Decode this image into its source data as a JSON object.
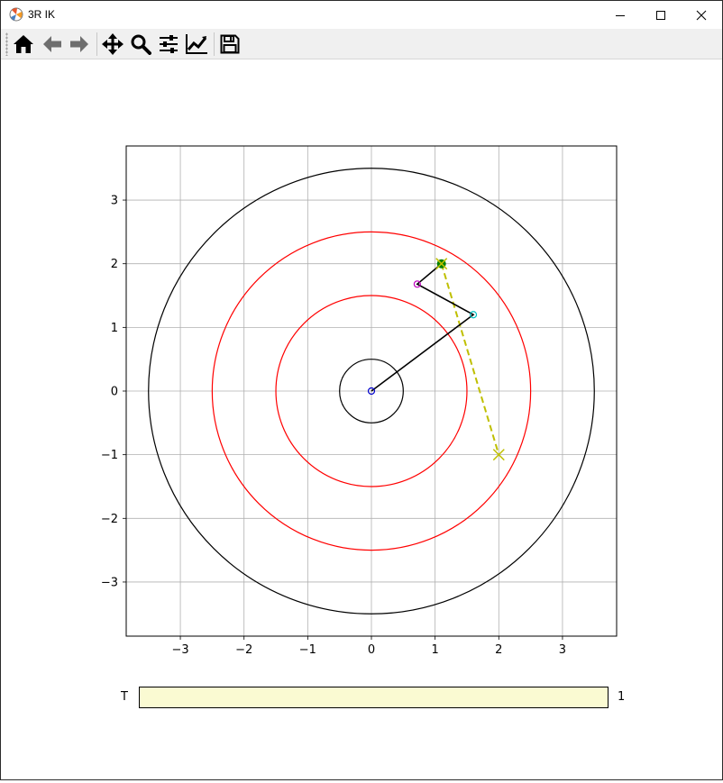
{
  "window": {
    "title": "3R IK"
  },
  "toolbar": {
    "buttons": [
      {
        "name": "home-button",
        "icon": "home-icon"
      },
      {
        "name": "back-button",
        "icon": "arrow-left-icon"
      },
      {
        "name": "forward-button",
        "icon": "arrow-right-icon"
      },
      {
        "name": "pan-button",
        "icon": "move-icon"
      },
      {
        "name": "zoom-button",
        "icon": "magnifier-icon"
      },
      {
        "name": "configure-subplots-button",
        "icon": "sliders-icon"
      },
      {
        "name": "edit-axis-button",
        "icon": "line-chart-icon"
      },
      {
        "name": "save-button",
        "icon": "floppy-disk-icon"
      }
    ]
  },
  "slider": {
    "label": "T",
    "value": "1",
    "fill_fraction": 1.0,
    "color": "#fafad2"
  },
  "chart_data": {
    "type": "line",
    "xlim": [
      -3.85,
      3.85
    ],
    "ylim": [
      -3.85,
      3.85
    ],
    "xticks": [
      -3,
      -2,
      -1,
      0,
      1,
      2,
      3
    ],
    "yticks": [
      -3,
      -2,
      -1,
      0,
      1,
      2,
      3
    ],
    "xtick_labels": [
      "−3",
      "−2",
      "−1",
      "0",
      "1",
      "2",
      "3"
    ],
    "ytick_labels": [
      "−3",
      "−2",
      "−1",
      "0",
      "1",
      "2",
      "3"
    ],
    "grid": true,
    "circles": [
      {
        "r": 0.5,
        "color": "#000000"
      },
      {
        "r": 1.5,
        "color": "#ff0000"
      },
      {
        "r": 2.5,
        "color": "#ff0000"
      },
      {
        "r": 3.5,
        "color": "#000000"
      }
    ],
    "arm": {
      "color": "#000000",
      "points": [
        [
          0,
          0
        ],
        [
          1.6,
          1.2
        ],
        [
          0.72,
          1.68
        ],
        [
          1.1,
          2.0
        ]
      ]
    },
    "joints": [
      {
        "x": 0,
        "y": 0,
        "color": "#0000cc"
      },
      {
        "x": 1.6,
        "y": 1.2,
        "color": "#00bfbf"
      },
      {
        "x": 0.72,
        "y": 1.68,
        "color": "#bf00bf"
      }
    ],
    "end_effector": {
      "x": 1.1,
      "y": 2.0,
      "color": "#008000"
    },
    "path": {
      "color": "#bfbf00",
      "points": [
        [
          1.1,
          2.0
        ],
        [
          2.0,
          -1.0
        ]
      ]
    },
    "markers_x": [
      {
        "x": 1.1,
        "y": 2.0,
        "color": "#bfbf00"
      },
      {
        "x": 2.0,
        "y": -1.0,
        "color": "#bfbf00"
      }
    ]
  }
}
